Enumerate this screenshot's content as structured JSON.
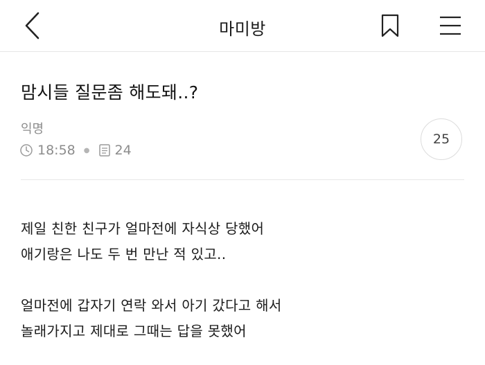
{
  "header": {
    "title": "마미방",
    "back_icon": "chevron-left-icon",
    "bookmark_icon": "bookmark-icon",
    "menu_icon": "hamburger-menu-icon"
  },
  "post": {
    "title": "맘시들 질문좀 해도돼..?",
    "author": "익명",
    "time": "18:58",
    "views": "24",
    "comment_count": "25",
    "body_lines": [
      "제일 친한 친구가 얼마전에 자식상 당했어",
      "애기랑은 나도 두 번 만난 적 있고..",
      "",
      "얼마전에 갑자기 연락 와서 아기 갔다고 해서",
      "놀래가지고 제대로 그때는 답을 못했어"
    ]
  },
  "colors": {
    "text": "#1a1a1a",
    "meta": "#8c8c8c",
    "border": "#e6e6e6"
  }
}
